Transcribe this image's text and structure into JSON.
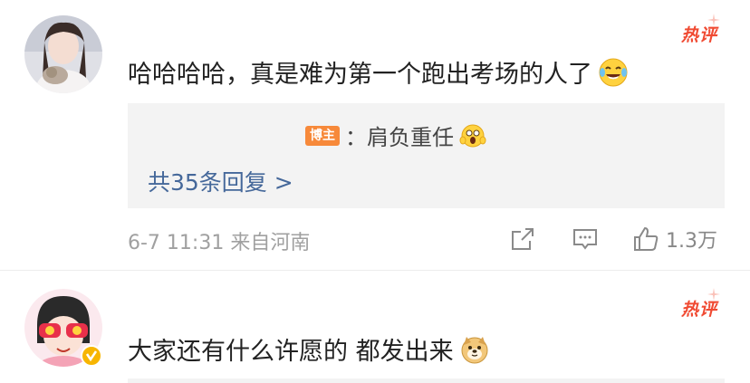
{
  "comments": [
    {
      "hot_label": "热评",
      "text": "哈哈哈哈，真是难为第一个跑出考场的人了",
      "emoji": "laughing-crying-emoji",
      "reply": {
        "badge": "博主",
        "text": "：肩负重任",
        "emoji": "shocked-emoji"
      },
      "reply_count": "共35条回复 >",
      "meta": "6-7 11:31 来自河南",
      "like_count": "1.3万"
    },
    {
      "hot_label": "热评",
      "text": "大家还有什么许愿的 都发出来",
      "emoji": "doge-emoji",
      "verified": true
    }
  ],
  "colors": {
    "hot": "#f04a32",
    "link": "#45689a",
    "badge": "#f7893a",
    "meta": "#a0a0a0",
    "reply_bg": "#f3f3f3"
  }
}
